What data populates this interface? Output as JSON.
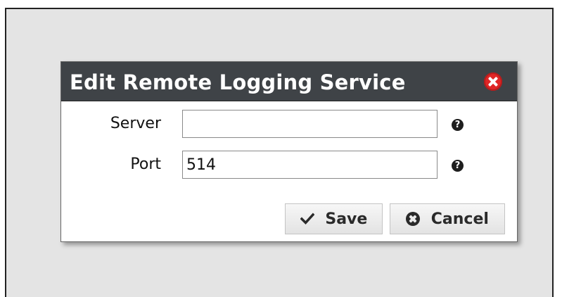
{
  "dialog": {
    "title": "Edit Remote Logging Service",
    "close_icon": "close-circle-icon"
  },
  "form": {
    "server": {
      "label": "Server",
      "value": "",
      "help_icon": "question-circle-icon"
    },
    "port": {
      "label": "Port",
      "value": "514",
      "help_icon": "question-circle-icon"
    }
  },
  "buttons": {
    "save": {
      "label": "Save",
      "icon": "checkmark-icon"
    },
    "cancel": {
      "label": "Cancel",
      "icon": "cancel-circle-icon"
    }
  },
  "colors": {
    "titlebar": "#3f4347",
    "close": "#e02626",
    "backdrop": "#e4e4e4"
  }
}
